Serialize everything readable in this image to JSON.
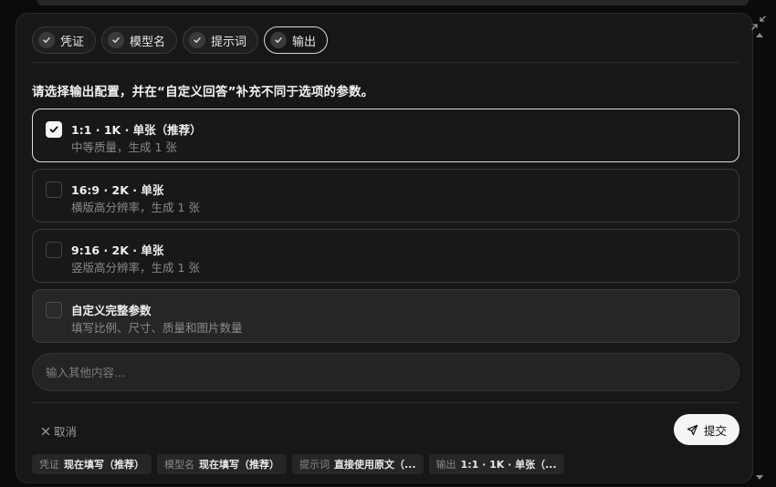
{
  "tabs": [
    {
      "label": "凭证",
      "active": false
    },
    {
      "label": "模型名",
      "active": false
    },
    {
      "label": "提示词",
      "active": false
    },
    {
      "label": "输出",
      "active": true
    }
  ],
  "question": "请选择输出配置，并在“自定义回答”补充不同于选项的参数。",
  "options": [
    {
      "title": "1:1 · 1K · 单张（推荐）",
      "subtitle": "中等质量，生成 1 张",
      "selected": true
    },
    {
      "title": "16:9 · 2K · 单张",
      "subtitle": "横版高分辨率，生成 1 张",
      "selected": false
    },
    {
      "title": "9:16 · 2K · 单张",
      "subtitle": "竖版高分辨率，生成 1 张",
      "selected": false
    },
    {
      "title": "自定义完整参数",
      "subtitle": "填写比例、尺寸、质量和图片数量",
      "selected": false
    }
  ],
  "other_input": {
    "placeholder": "输入其他内容...",
    "value": ""
  },
  "actions": {
    "cancel_label": "取消",
    "submit_label": "提交"
  },
  "summary": [
    {
      "key": "凭证",
      "value": "现在填写（推荐）"
    },
    {
      "key": "模型名",
      "value": "现在填写（推荐）"
    },
    {
      "key": "提示词",
      "value": "直接使用原文（..."
    },
    {
      "key": "输出",
      "value": "1:1 · 1K · 单张（..."
    }
  ]
}
